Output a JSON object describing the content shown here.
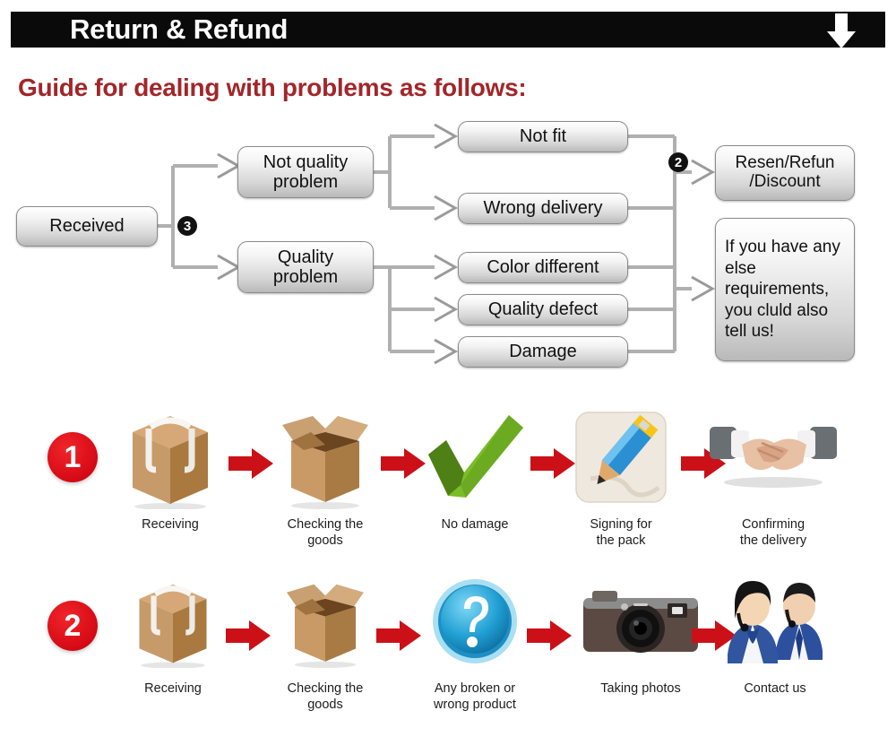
{
  "header": {
    "title": "Return & Refund",
    "arrow_icon": "down-arrow-icon",
    "background_color": "#0a0a0a",
    "text_color": "#ffffff"
  },
  "guide": {
    "heading": "Guide for dealing with problems as follows:",
    "color": "#a2262a"
  },
  "flowchart": {
    "nodes": {
      "received": "Received",
      "not_quality_problem": "Not quality\nproblem",
      "quality_problem": "Quality\nproblem",
      "not_fit": "Not fit",
      "wrong_delivery": "Wrong delivery",
      "color_different": "Color different",
      "quality_defect": "Quality defect",
      "damage": "Damage",
      "resend_refund_discount": "Resen/Refun\n/Discount",
      "extra_requirements": "If you have any else requirements, you cluld also tell us!"
    },
    "badges": {
      "badge_three": "3",
      "badge_two": "2"
    }
  },
  "process": {
    "rows": [
      {
        "number": "1",
        "steps": [
          {
            "icon": "sealed-box-icon",
            "label": "Receiving"
          },
          {
            "icon": "open-box-icon",
            "label": "Checking the\ngoods"
          },
          {
            "icon": "green-check-icon",
            "label": "No damage"
          },
          {
            "icon": "pencil-signing-icon",
            "label": "Signing for\nthe pack"
          },
          {
            "icon": "handshake-icon",
            "label": "Confirming\nthe delivery"
          }
        ]
      },
      {
        "number": "2",
        "steps": [
          {
            "icon": "sealed-box-icon",
            "label": "Receiving"
          },
          {
            "icon": "open-box-icon",
            "label": "Checking the\ngoods"
          },
          {
            "icon": "question-mark-icon",
            "label": "Any broken or\nwrong product"
          },
          {
            "icon": "camera-icon",
            "label": "Taking photos"
          },
          {
            "icon": "support-agents-icon",
            "label": "Contact us"
          }
        ]
      }
    ],
    "arrow_icon": "red-right-arrow-icon",
    "arrow_color": "#cc1018"
  }
}
